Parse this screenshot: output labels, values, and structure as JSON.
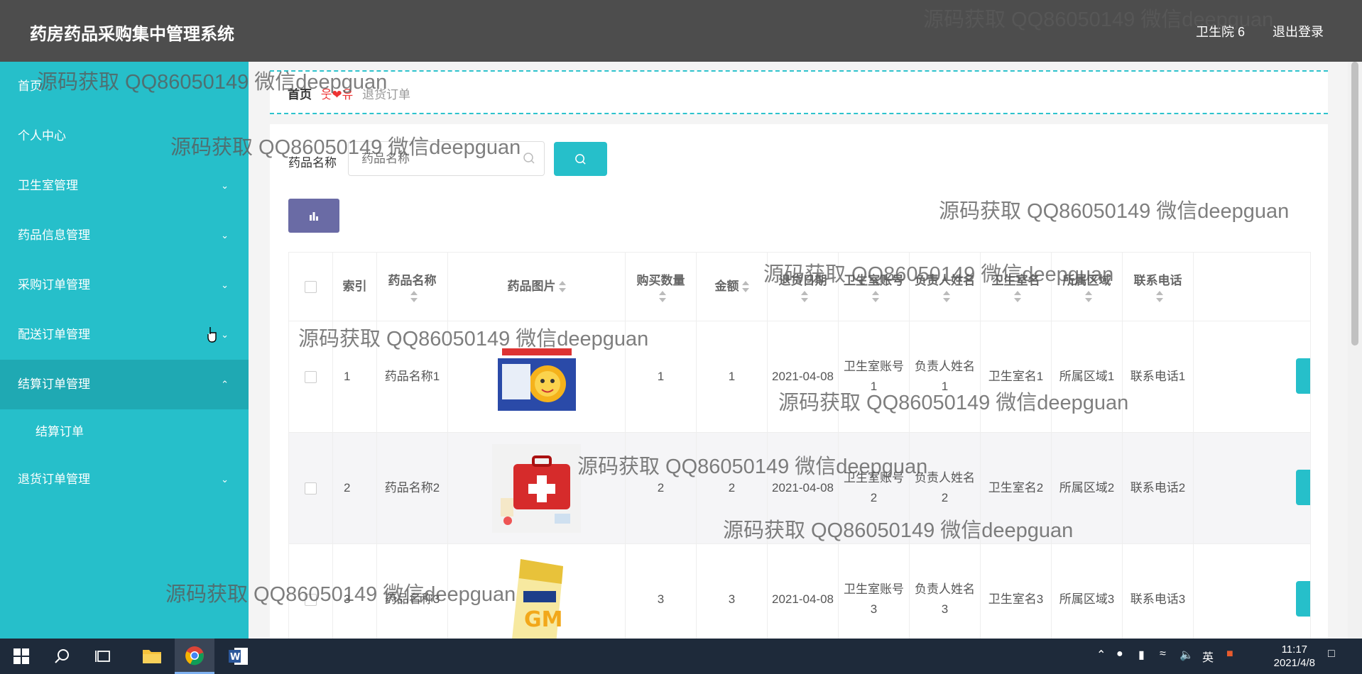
{
  "header": {
    "title": "药房药品采购集中管理系统",
    "user": "卫生院 6",
    "logout": "退出登录"
  },
  "sidebar": {
    "items": [
      {
        "label": "首页",
        "has_chevron": false
      },
      {
        "label": "个人中心",
        "has_chevron": false
      },
      {
        "label": "卫生室管理",
        "has_chevron": true
      },
      {
        "label": "药品信息管理",
        "has_chevron": true
      },
      {
        "label": "采购订单管理",
        "has_chevron": true
      },
      {
        "label": "配送订单管理",
        "has_chevron": true
      },
      {
        "label": "结算订单管理",
        "has_chevron": true,
        "expanded": true
      },
      {
        "label": "退货订单管理",
        "has_chevron": true
      }
    ],
    "sub_item": "结算订单"
  },
  "breadcrumb": {
    "home": "首页",
    "separator": "웃❤유",
    "current": "退货订单"
  },
  "search": {
    "label": "药品名称",
    "placeholder": "药品名称"
  },
  "table": {
    "headers": [
      "索引",
      "药品名称",
      "药品图片",
      "购买数量",
      "金额",
      "退货日期",
      "卫生室账号",
      "负责人姓名",
      "卫生室名",
      "所属区域",
      "联系电话"
    ],
    "rows": [
      {
        "index": "1",
        "name": "药品名称1",
        "qty": "1",
        "amount": "1",
        "date": "2021-04-08",
        "account": "卫生室账号1",
        "person": "负责人姓名1",
        "room": "卫生室名1",
        "region": "所属区域1",
        "phone": "联系电话1",
        "image": "children's medicine box"
      },
      {
        "index": "2",
        "name": "药品名称2",
        "qty": "2",
        "amount": "2",
        "date": "2021-04-08",
        "account": "卫生室账号2",
        "person": "负责人姓名2",
        "room": "卫生室名2",
        "region": "所属区域2",
        "phone": "联系电话2",
        "image": "red first aid kit"
      },
      {
        "index": "3",
        "name": "药品名称3",
        "qty": "3",
        "amount": "3",
        "date": "2021-04-08",
        "account": "卫生室账号3",
        "person": "负责人姓名3",
        "room": "卫生室名3",
        "region": "所属区域3",
        "phone": "联系电话3",
        "image": "yellow GM medicine box"
      }
    ]
  },
  "watermark": "源码获取 QQ86050149 微信deepguan",
  "taskbar": {
    "ime": "英",
    "time": "11:17",
    "date": "2021/4/8"
  },
  "colors": {
    "sidebar": "#26bfca",
    "topbar": "#4d4d4d",
    "accent": "#26bfca",
    "stats_button": "#6a6ba5"
  }
}
